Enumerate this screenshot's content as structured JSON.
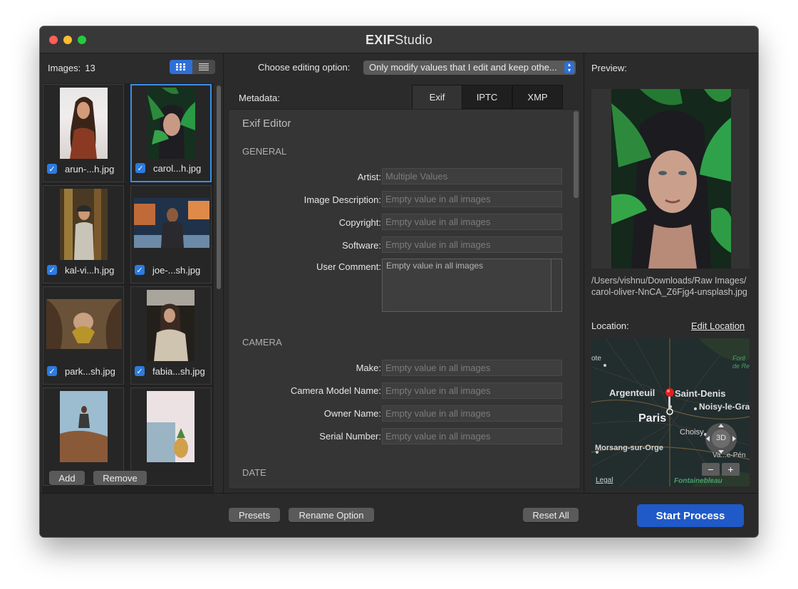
{
  "window": {
    "title_bold": "EXIF",
    "title_rest": "Studio"
  },
  "left": {
    "images_label": "Images:",
    "images_count": "13",
    "view_modes": [
      "grid-icon",
      "list-icon"
    ],
    "thumbnails": [
      {
        "name": "arun-...h.jpg",
        "checked": true,
        "selected": false
      },
      {
        "name": "carol...h.jpg",
        "checked": true,
        "selected": true
      },
      {
        "name": "kal-vi...h.jpg",
        "checked": true,
        "selected": false
      },
      {
        "name": "joe-...sh.jpg",
        "checked": true,
        "selected": false
      },
      {
        "name": "park...sh.jpg",
        "checked": true,
        "selected": false
      },
      {
        "name": "fabia...sh.jpg",
        "checked": true,
        "selected": false
      },
      {
        "name": "",
        "checked": false,
        "selected": false
      },
      {
        "name": "",
        "checked": false,
        "selected": false
      }
    ],
    "add_label": "Add",
    "remove_label": "Remove"
  },
  "middle": {
    "editing_option_label": "Choose editing option:",
    "editing_option_value": "Only modify values that I edit and keep othe...",
    "metadata_label": "Metadata:",
    "tabs": [
      {
        "label": "Exif",
        "active": true
      },
      {
        "label": "IPTC",
        "active": false
      },
      {
        "label": "XMP",
        "active": false
      }
    ],
    "editor_title": "Exif Editor",
    "general": {
      "heading": "GENERAL",
      "artist_label": "Artist:",
      "artist_placeholder": "Multiple Values",
      "image_description_label": "Image Description:",
      "image_description_placeholder": "Empty value in all images",
      "copyright_label": "Copyright:",
      "copyright_placeholder": "Empty value in all images",
      "software_label": "Software:",
      "software_placeholder": "Empty value in all images",
      "user_comment_label": "User Comment:",
      "user_comment_placeholder": "Empty value in all images"
    },
    "camera": {
      "heading": "CAMERA",
      "make_label": "Make:",
      "make_placeholder": "Empty value in all images",
      "model_label": "Camera Model Name:",
      "model_placeholder": "Empty value in all images",
      "owner_label": "Owner Name:",
      "owner_placeholder": "Empty value in all images",
      "serial_label": "Serial Number:",
      "serial_placeholder": "Empty value in all images"
    },
    "date": {
      "heading": "DATE"
    }
  },
  "right": {
    "preview_label": "Preview:",
    "path_line1": "/Users/vishnu/Downloads/Raw Images/",
    "path_line2": "carol-oliver-NnCA_Z6Fjg4-unsplash.jpg",
    "location_label": "Location:",
    "edit_location_label": "Edit Location",
    "map": {
      "places": [
        "ote",
        "Forê de Re",
        "Argenteuil",
        "Saint-Denis",
        "Noisy-le-Gra",
        "Paris",
        "Choisy",
        "Morsang-sur-Orge",
        "Va...e-Pén",
        "Fontainebleau"
      ],
      "compass_label": "3D",
      "zoom_out": "−",
      "zoom_in": "+",
      "legal": "Legal"
    }
  },
  "bottom": {
    "presets_label": "Presets",
    "rename_label": "Rename Option",
    "reset_label": "Reset All",
    "start_label": "Start Process"
  },
  "colors": {
    "accent": "#1f5ac8",
    "checkbox": "#2d7be0",
    "selection_border": "#3a8ee6",
    "traffic_close": "#ff5f57",
    "traffic_min": "#febc2e",
    "traffic_max": "#28c840"
  }
}
